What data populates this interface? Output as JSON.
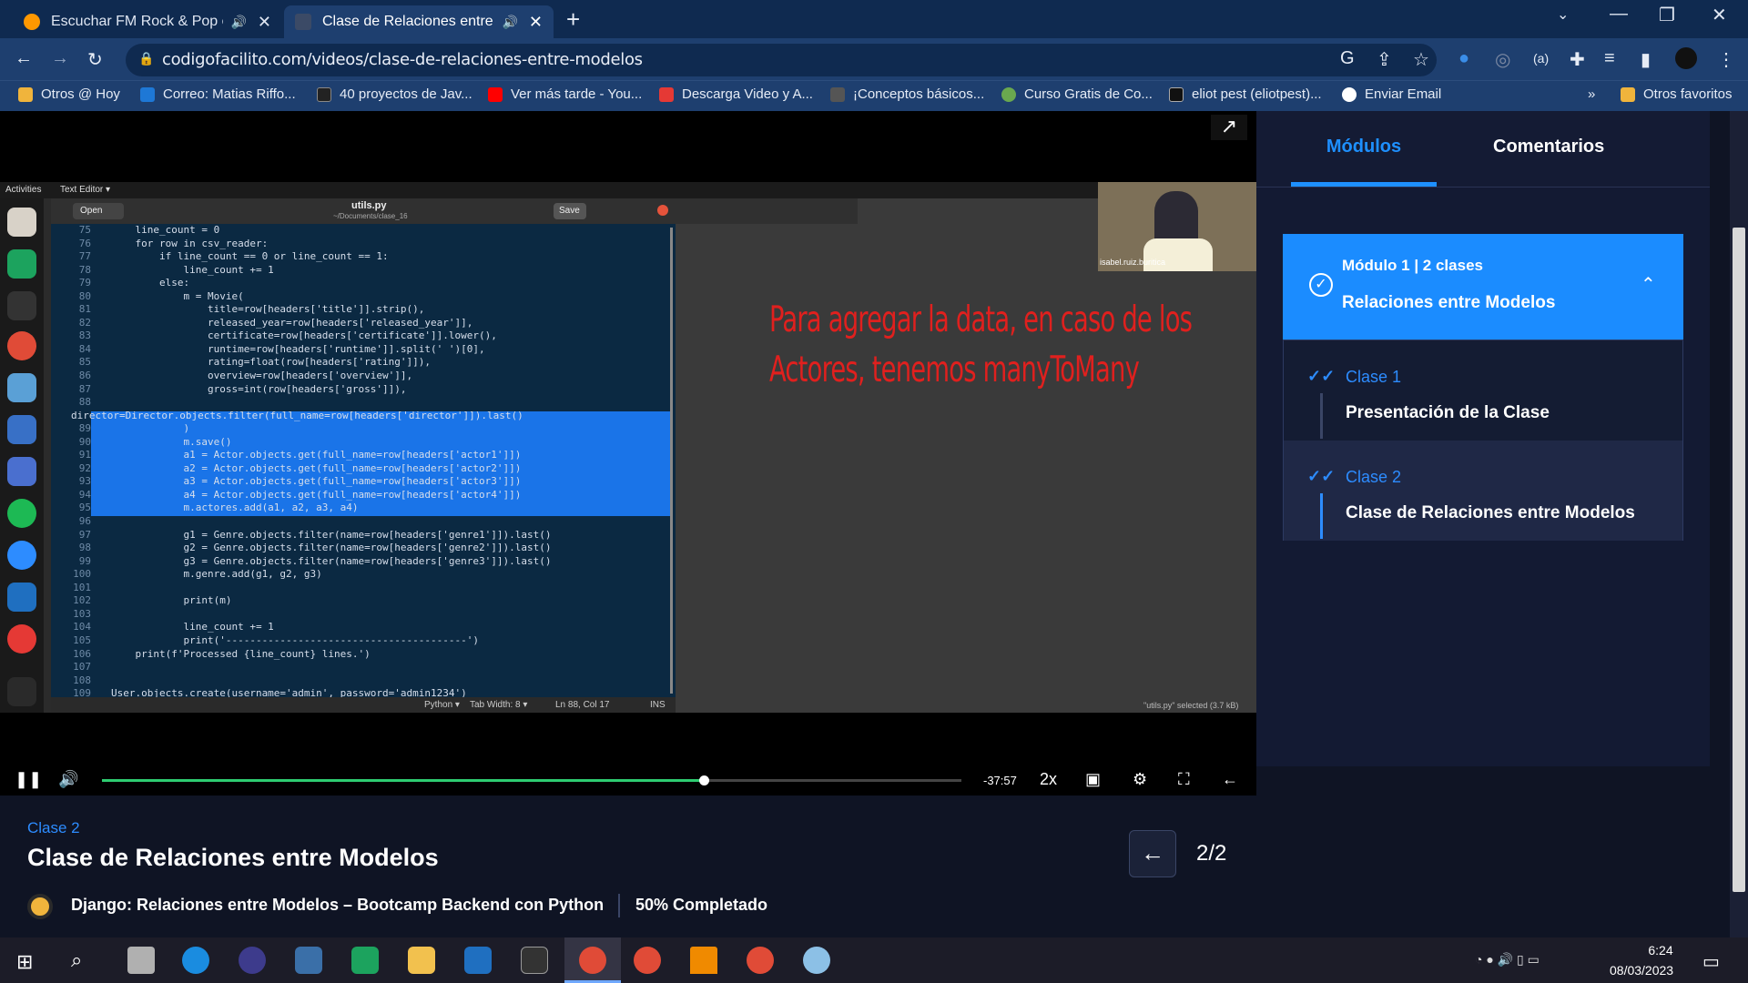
{
  "browser": {
    "tabs": [
      {
        "title": "Escuchar FM Rock & Pop en",
        "audio": "🔊",
        "close": "✕",
        "active": false
      },
      {
        "title": "Clase de Relaciones entre M",
        "audio": "🔊",
        "close": "✕",
        "active": true
      }
    ],
    "new_tab": "+",
    "url": "codigofacilito.com/videos/clase-de-relaciones-entre-modelos",
    "bookmarks": [
      {
        "label": "Otros @ Hoy",
        "color": "#f0b43c"
      },
      {
        "label": "Correo: Matias Riffo...",
        "color": "#1e78d6"
      },
      {
        "label": "40 proyectos de Jav...",
        "color": "#222222"
      },
      {
        "label": "Ver más tarde - You...",
        "color": "#ff0000"
      },
      {
        "label": "Descarga Video y A...",
        "color": "#e53935"
      },
      {
        "label": "¡Conceptos básicos...",
        "color": "#555555"
      },
      {
        "label": "Curso Gratis de Co...",
        "color": "#6aa84f"
      },
      {
        "label": "eliot pest (eliotpest)...",
        "color": "#111111"
      },
      {
        "label": "Enviar Email",
        "color": "#ffffff"
      }
    ],
    "bookmarks_more": "»",
    "other_bookmarks": "Otros favoritos"
  },
  "video": {
    "gnome_activities": "Activities",
    "gnome_app": "Text Editor ▾",
    "editor": {
      "open": "Open",
      "filename": "utils.py",
      "path": "~/Documents/clase_16",
      "save": "Save",
      "status_lang": "Python ▾",
      "status_tab": "Tab Width: 8 ▾",
      "status_pos": "Ln 88, Col 17",
      "status_ins": "INS",
      "selected_info": "\"utils.py\" selected (3.7 kB)"
    },
    "webcam_label": "isabel.ruiz.buritica",
    "annotation": "Para agregar la data, en caso de los Actores, tenemos manyToMany",
    "controls": {
      "time": "-37:57",
      "speed": "2x",
      "progress": 0.7
    }
  },
  "code_lines": [
    {
      "n": "75",
      "t": "    line_count = 0"
    },
    {
      "n": "76",
      "t": "    for row in csv_reader:"
    },
    {
      "n": "77",
      "t": "        if line_count == 0 or line_count == 1:"
    },
    {
      "n": "78",
      "t": "            line_count += 1"
    },
    {
      "n": "79",
      "t": "        else:"
    },
    {
      "n": "80",
      "t": "            m = Movie("
    },
    {
      "n": "81",
      "t": "                title=row[headers['title']].strip(),"
    },
    {
      "n": "82",
      "t": "                released_year=row[headers['released_year']],"
    },
    {
      "n": "83",
      "t": "                certificate=row[headers['certificate']].lower(),"
    },
    {
      "n": "84",
      "t": "                runtime=row[headers['runtime']].split(' ')[0],"
    },
    {
      "n": "85",
      "t": "                rating=float(row[headers['rating']]),"
    },
    {
      "n": "86",
      "t": "                overview=row[headers['overview']],"
    },
    {
      "n": "87",
      "t": "                gross=int(row[headers['gross']]),"
    },
    {
      "n": "88",
      "t": ""
    },
    {
      "n": "",
      "t": "director=Director.objects.filter(full_name=row[headers['director']]).last()"
    },
    {
      "n": "89",
      "t": "            )"
    },
    {
      "n": "90",
      "t": "            m.save()"
    },
    {
      "n": "91",
      "t": "            a1 = Actor.objects.get(full_name=row[headers['actor1']])"
    },
    {
      "n": "92",
      "t": "            a2 = Actor.objects.get(full_name=row[headers['actor2']])"
    },
    {
      "n": "93",
      "t": "            a3 = Actor.objects.get(full_name=row[headers['actor3']])"
    },
    {
      "n": "94",
      "t": "            a4 = Actor.objects.get(full_name=row[headers['actor4']])"
    },
    {
      "n": "95",
      "t": "            m.actores.add(a1, a2, a3, a4)"
    },
    {
      "n": "96",
      "t": ""
    },
    {
      "n": "97",
      "t": "            g1 = Genre.objects.filter(name=row[headers['genre1']]).last()"
    },
    {
      "n": "98",
      "t": "            g2 = Genre.objects.filter(name=row[headers['genre2']]).last()"
    },
    {
      "n": "99",
      "t": "            g3 = Genre.objects.filter(name=row[headers['genre3']]).last()"
    },
    {
      "n": "100",
      "t": "            m.genre.add(g1, g2, g3)"
    },
    {
      "n": "101",
      "t": ""
    },
    {
      "n": "102",
      "t": "            print(m)"
    },
    {
      "n": "103",
      "t": ""
    },
    {
      "n": "104",
      "t": "            line_count += 1"
    },
    {
      "n": "105",
      "t": "            print('----------------------------------------')"
    },
    {
      "n": "106",
      "t": "    print(f'Processed {line_count} lines.')"
    },
    {
      "n": "107",
      "t": ""
    },
    {
      "n": "108",
      "t": ""
    },
    {
      "n": "109",
      "t": "User.objects.create(username='admin', password='admin1234')"
    }
  ],
  "sidebar": {
    "tab_modules": "Módulos",
    "tab_comments": "Comentarios",
    "module": {
      "meta": "Módulo 1  |  2 clases",
      "title": "Relaciones entre Modelos"
    },
    "classes": [
      {
        "label": "Clase 1",
        "title": "Presentación de la Clase"
      },
      {
        "label": "Clase 2",
        "title": "Clase de Relaciones entre Modelos"
      }
    ]
  },
  "page": {
    "class_label": "Clase 2",
    "class_title": "Clase de Relaciones entre Modelos",
    "pager": "2/2",
    "course": "Django: Relaciones entre Modelos – Bootcamp Backend con Python",
    "completed": "50% Completado"
  },
  "taskbar": {
    "time": "6:24",
    "date": "08/03/2023"
  }
}
